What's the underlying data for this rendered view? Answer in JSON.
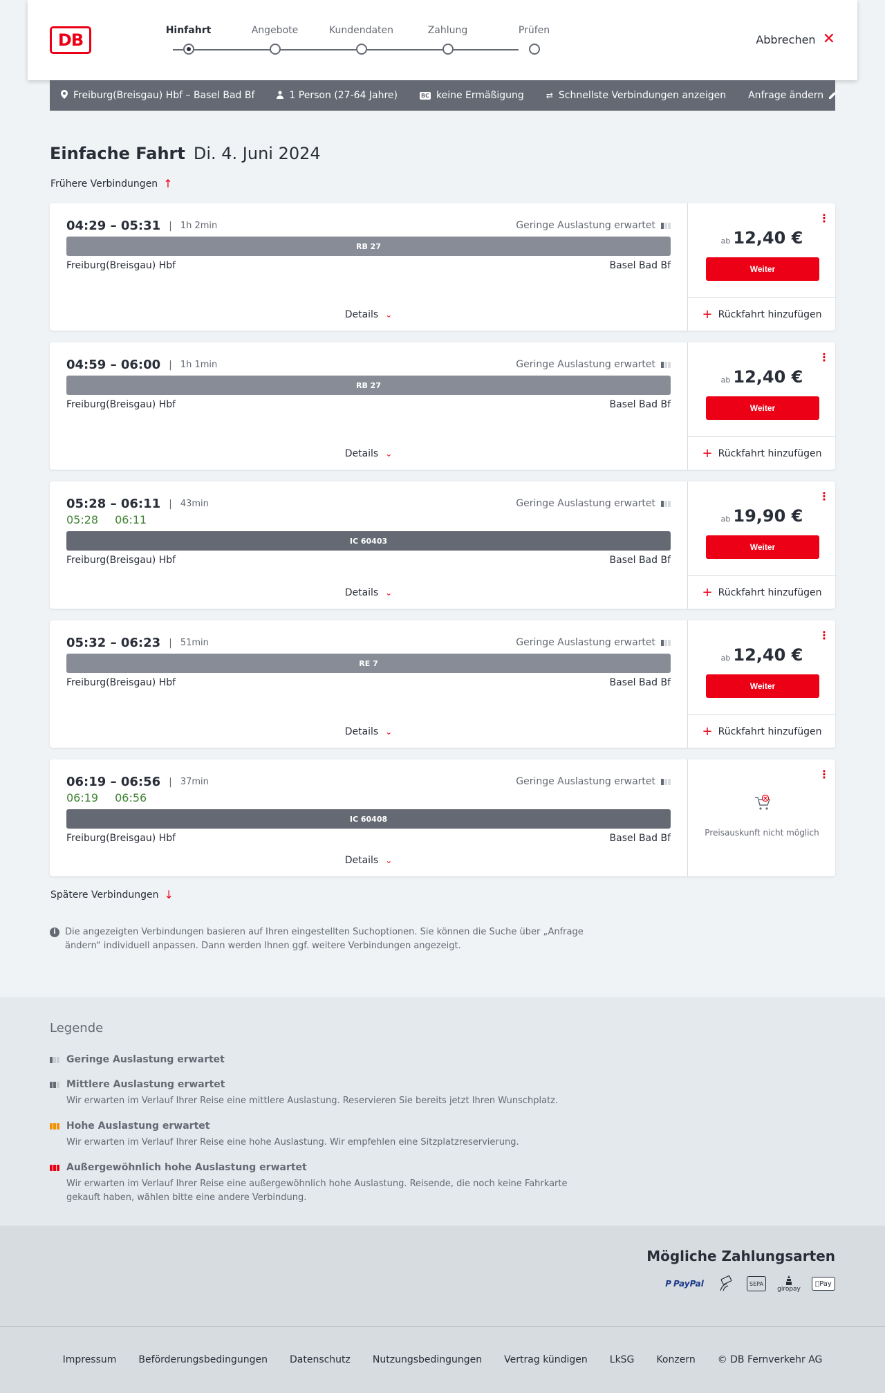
{
  "header": {
    "logo_text": "DB",
    "steps": [
      {
        "label": "Hinfahrt",
        "active": true
      },
      {
        "label": "Angebote",
        "active": false
      },
      {
        "label": "Kundendaten",
        "active": false
      },
      {
        "label": "Zahlung",
        "active": false
      },
      {
        "label": "Prüfen",
        "active": false
      }
    ],
    "cancel_label": "Abbrechen"
  },
  "searchbar": {
    "route": "Freiburg(Breisgau) Hbf – Basel Bad Bf",
    "passengers": "1 Person (27-64 Jahre)",
    "discount_badge": "BC",
    "discount": "keine Ermäßigung",
    "option": "Schnellste Verbindungen anzeigen",
    "change_label": "Anfrage ändern"
  },
  "title": {
    "trip_type": "Einfache Fahrt",
    "date": "Di. 4. Juni 2024"
  },
  "earlier_label": "Frühere Verbindungen",
  "later_label": "Spätere Verbindungen",
  "connections": [
    {
      "times": "04:29 – 05:31",
      "duration": "1h 2min",
      "realtime_dep": "",
      "realtime_arr": "",
      "occupancy": "Geringe Auslastung erwartet",
      "train": "RB 27",
      "train_kind": "regional",
      "from": "Freiburg(Breisgau) Hbf",
      "to": "Basel Bad Bf",
      "details_label": "Details",
      "price_prefix": "ab",
      "price": "12,40 €",
      "button_label": "Weiter",
      "return_label": "Rückfahrt hinzufügen",
      "no_price": ""
    },
    {
      "times": "04:59 – 06:00",
      "duration": "1h 1min",
      "realtime_dep": "",
      "realtime_arr": "",
      "occupancy": "Geringe Auslastung erwartet",
      "train": "RB 27",
      "train_kind": "regional",
      "from": "Freiburg(Breisgau) Hbf",
      "to": "Basel Bad Bf",
      "details_label": "Details",
      "price_prefix": "ab",
      "price": "12,40 €",
      "button_label": "Weiter",
      "return_label": "Rückfahrt hinzufügen",
      "no_price": ""
    },
    {
      "times": "05:28 – 06:11",
      "duration": "43min",
      "realtime_dep": "05:28",
      "realtime_arr": "06:11",
      "occupancy": "Geringe Auslastung erwartet",
      "train": "IC 60403",
      "train_kind": "ic",
      "from": "Freiburg(Breisgau) Hbf",
      "to": "Basel Bad Bf",
      "details_label": "Details",
      "price_prefix": "ab",
      "price": "19,90 €",
      "button_label": "Weiter",
      "return_label": "Rückfahrt hinzufügen",
      "no_price": ""
    },
    {
      "times": "05:32 – 06:23",
      "duration": "51min",
      "realtime_dep": "",
      "realtime_arr": "",
      "occupancy": "Geringe Auslastung erwartet",
      "train": "RE 7",
      "train_kind": "regional",
      "from": "Freiburg(Breisgau) Hbf",
      "to": "Basel Bad Bf",
      "details_label": "Details",
      "price_prefix": "ab",
      "price": "12,40 €",
      "button_label": "Weiter",
      "return_label": "Rückfahrt hinzufügen",
      "no_price": ""
    },
    {
      "times": "06:19 – 06:56",
      "duration": "37min",
      "realtime_dep": "06:19",
      "realtime_arr": "06:56",
      "occupancy": "Geringe Auslastung erwartet",
      "train": "IC 60408",
      "train_kind": "ic",
      "from": "Freiburg(Breisgau) Hbf",
      "to": "Basel Bad Bf",
      "details_label": "Details",
      "price_prefix": "",
      "price": "",
      "button_label": "",
      "return_label": "",
      "no_price": "Preisauskunft nicht möglich"
    }
  ],
  "info_text": "Die angezeigten Verbindungen basieren auf Ihren eingestellten Suchoptionen. Sie können die Suche über „Anfrage ändern“ individuell anpassen. Dann werden Ihnen ggf. weitere Verbindungen angezeigt.",
  "legend": {
    "title": "Legende",
    "items": [
      {
        "label": "Geringe Auslastung erwartet",
        "desc": "",
        "level": "low"
      },
      {
        "label": "Mittlere Auslastung erwartet",
        "desc": "Wir erwarten im Verlauf Ihrer Reise eine mittlere Auslastung. Reservieren Sie bereits jetzt Ihren Wunschplatz.",
        "level": "medium"
      },
      {
        "label": "Hohe Auslastung erwartet",
        "desc": "Wir erwarten im Verlauf Ihrer Reise eine hohe Auslastung. Wir empfehlen eine Sitzplatzreservierung.",
        "level": "high"
      },
      {
        "label": "Außergewöhnlich hohe Auslastung erwartet",
        "desc": "Wir erwarten im Verlauf Ihrer Reise eine außergewöhnlich hohe Auslastung. Reisende, die noch keine Fahrkarte gekauft haben, wählen bitte eine andere Verbindung.",
        "level": "extreme"
      }
    ]
  },
  "payment": {
    "title": "Mögliche Zahlungsarten",
    "methods": [
      "PayPal",
      "Kreditkarte",
      "SEPA",
      "giropay",
      "Apple Pay"
    ],
    "labels": {
      "paypal": "PayPal",
      "sepa": "SEPA",
      "giropay": "giropay",
      "applepay": "Pay"
    }
  },
  "footer": {
    "links": [
      "Impressum",
      "Beförderungsbedingungen",
      "Datenschutz",
      "Nutzungsbedingungen",
      "Vertrag kündigen",
      "LkSG",
      "Konzern",
      "© DB Fernverkehr AG"
    ]
  },
  "colors": {
    "brand_red": "#ec0016",
    "realtime_green": "#408335",
    "bar_dark": "#646973",
    "bar_light": "#878c96"
  }
}
